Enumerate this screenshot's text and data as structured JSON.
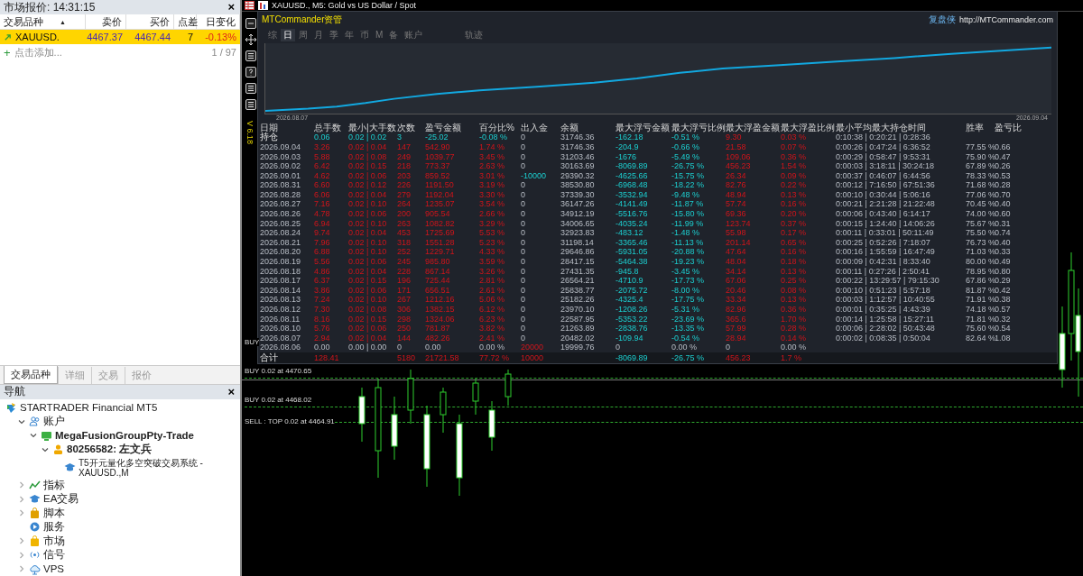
{
  "market_watch": {
    "title": "市场报价: 14:31:15",
    "close": "×",
    "columns": [
      {
        "label": "交易品种",
        "sort": "▲"
      },
      {
        "label": "卖价"
      },
      {
        "label": "买价"
      },
      {
        "label": "点差"
      },
      {
        "label": "日变化"
      }
    ],
    "rows": [
      {
        "selected": true,
        "cells": [
          "XAUUSD.",
          "4467.37",
          "4467.44",
          "7",
          "-0.13%"
        ]
      }
    ],
    "add_row": {
      "icon": "+",
      "label": "点击添加...",
      "count": "1 / 97"
    },
    "tabs": [
      {
        "label": "交易品种",
        "selected": true
      },
      {
        "label": "详细",
        "selected": false
      },
      {
        "label": "交易",
        "selected": false
      },
      {
        "label": "报价",
        "selected": false
      }
    ]
  },
  "navigator": {
    "title": "导航",
    "close": "×",
    "items": [
      {
        "kind": "broker",
        "label": "STARTRADER Financial MT5",
        "children": [
          {
            "kind": "accounts",
            "label": "账户",
            "expanded": true,
            "children": [
              {
                "kind": "server",
                "label": "MegaFusionGroupPty-Trade",
                "expanded": true,
                "children": [
                  {
                    "kind": "user",
                    "label": "80256582: 左文兵",
                    "expanded": true,
                    "children": [
                      {
                        "kind": "expert",
                        "label": "T5开元量化多空突破交易系统 - XAUUSD.,M"
                      }
                    ]
                  }
                ]
              }
            ]
          },
          {
            "kind": "indicators",
            "label": "指标",
            "expanded": false
          },
          {
            "kind": "experts",
            "label": "EA交易",
            "expanded": false
          },
          {
            "kind": "scripts",
            "label": "脚本",
            "expanded": false
          },
          {
            "kind": "services",
            "label": "服务"
          },
          {
            "kind": "market",
            "label": "市场",
            "expanded": false
          },
          {
            "kind": "signals",
            "label": "信号",
            "expanded": false
          },
          {
            "kind": "vps",
            "label": "VPS",
            "expanded": false
          }
        ]
      }
    ]
  },
  "chart": {
    "title": "XAUUSD., M5:  Gold vs US Dollar / Spot",
    "version": "V 6.18",
    "order_lines": [
      {
        "kind": "buy",
        "label": "BUY"
      },
      {
        "kind": "buy",
        "label": "BUY 0.02 at 4470.65"
      },
      {
        "kind": "buy",
        "label": "BUY 0.02 at 4468.02"
      },
      {
        "kind": "sell",
        "label": "SELL : TOP 0.02 at 4464.91"
      }
    ]
  },
  "panel": {
    "title": "MTCommander资管",
    "brand": "复盘侠",
    "url": "http://MTCommander.com",
    "tabs": [
      {
        "label": "综",
        "selected": false
      },
      {
        "label": "日",
        "selected": true
      },
      {
        "label": "周",
        "selected": false
      },
      {
        "label": "月",
        "selected": false
      },
      {
        "label": "季",
        "selected": false
      },
      {
        "label": "年",
        "selected": false
      },
      {
        "label": "币",
        "selected": false
      },
      {
        "label": "M",
        "selected": false
      },
      {
        "label": "备",
        "selected": false
      },
      {
        "label": "账户",
        "selected": false
      },
      {
        "label": "轨迹",
        "selected": false
      }
    ],
    "equity_start": "2026.08.07",
    "equity_end": "2026.09.04",
    "columns": [
      "日期",
      "总手数",
      "最小|大手数",
      "次数",
      "盈亏金额",
      "百分比%",
      "出入金",
      "余额",
      "最大浮亏金额",
      "最大浮亏比例",
      "最大浮盈金额",
      "最大浮盈比例",
      "最小平均最大持仓时间",
      "胜率",
      "盈亏比"
    ],
    "rows": [
      {
        "kind": "position",
        "cells": [
          {
            "text": "持仓",
            "kind": "label"
          },
          {
            "text": "0.06",
            "kind": "loss"
          },
          {
            "text": "0.02 | 0.02",
            "kind": "loss"
          },
          {
            "text": "3",
            "kind": "loss"
          },
          {
            "text": "-25.02",
            "kind": "loss"
          },
          {
            "text": "-0.08 %",
            "kind": "loss"
          },
          {
            "text": "0",
            "kind": "plain"
          },
          {
            "text": "31746.36",
            "kind": "plain"
          },
          {
            "text": "-162.18",
            "kind": "loss"
          },
          {
            "text": "-0.51 %",
            "kind": "loss"
          },
          {
            "text": "9.30",
            "kind": "gain"
          },
          {
            "text": "0.03 %",
            "kind": "gain"
          },
          {
            "text": "0:10:38 | 0:20:21 | 0:28:36",
            "kind": "plain"
          },
          null,
          null
        ]
      },
      {
        "kind": "day",
        "cells": [
          {
            "text": "2026.09.04",
            "kind": "plain"
          },
          {
            "text": "3.26",
            "kind": "gain"
          },
          {
            "text": "0.02 | 0.04",
            "kind": "gain"
          },
          {
            "text": "147",
            "kind": "gain"
          },
          {
            "text": "542.90",
            "kind": "gain"
          },
          {
            "text": "1.74 %",
            "kind": "gain"
          },
          {
            "text": "0",
            "kind": "plain"
          },
          {
            "text": "31746.36",
            "kind": "plain"
          },
          {
            "text": "-204.9",
            "kind": "loss"
          },
          {
            "text": "-0.66 %",
            "kind": "loss"
          },
          {
            "text": "21.58",
            "kind": "gain"
          },
          {
            "text": "0.07 %",
            "kind": "gain"
          },
          {
            "text": "0:00:26 | 0:47:24 | 6:36:52",
            "kind": "plain"
          },
          {
            "text": "77.55 %",
            "kind": "plain"
          },
          {
            "text": "0.66",
            "kind": "plain"
          }
        ]
      },
      {
        "kind": "day",
        "cells": [
          {
            "text": "2026.09.03",
            "kind": "plain"
          },
          {
            "text": "5.88",
            "kind": "gain"
          },
          {
            "text": "0.02 | 0.08",
            "kind": "gain"
          },
          {
            "text": "249",
            "kind": "gain"
          },
          {
            "text": "1039.77",
            "kind": "gain"
          },
          {
            "text": "3.45 %",
            "kind": "gain"
          },
          {
            "text": "0",
            "kind": "plain"
          },
          {
            "text": "31203.46",
            "kind": "plain"
          },
          {
            "text": "-1676",
            "kind": "loss"
          },
          {
            "text": "-5.49 %",
            "kind": "loss"
          },
          {
            "text": "109.06",
            "kind": "gain"
          },
          {
            "text": "0.36 %",
            "kind": "gain"
          },
          {
            "text": "0:00:29 | 0:58:47 | 9:53:31",
            "kind": "plain"
          },
          {
            "text": "75.90 %",
            "kind": "plain"
          },
          {
            "text": "0.47",
            "kind": "plain"
          }
        ]
      },
      {
        "kind": "day",
        "cells": [
          {
            "text": "2026.09.02",
            "kind": "plain"
          },
          {
            "text": "6.42",
            "kind": "gain"
          },
          {
            "text": "0.02 | 0.15",
            "kind": "gain"
          },
          {
            "text": "218",
            "kind": "gain"
          },
          {
            "text": "773.37",
            "kind": "gain"
          },
          {
            "text": "2.63 %",
            "kind": "gain"
          },
          {
            "text": "0",
            "kind": "plain"
          },
          {
            "text": "30163.69",
            "kind": "plain"
          },
          {
            "text": "-8069.89",
            "kind": "loss"
          },
          {
            "text": "-26.75 %",
            "kind": "loss"
          },
          {
            "text": "456.23",
            "kind": "gain"
          },
          {
            "text": "1.54 %",
            "kind": "gain"
          },
          {
            "text": "0:00:03 | 3:18:11 | 30:24:18",
            "kind": "plain"
          },
          {
            "text": "67.89 %",
            "kind": "plain"
          },
          {
            "text": "0.26",
            "kind": "plain"
          }
        ]
      },
      {
        "kind": "day",
        "cells": [
          {
            "text": "2026.09.01",
            "kind": "plain"
          },
          {
            "text": "4.62",
            "kind": "gain"
          },
          {
            "text": "0.02 | 0.06",
            "kind": "gain"
          },
          {
            "text": "203",
            "kind": "gain"
          },
          {
            "text": "859.52",
            "kind": "gain"
          },
          {
            "text": "3.01 %",
            "kind": "gain"
          },
          {
            "text": "-10000",
            "kind": "loss"
          },
          {
            "text": "29390.32",
            "kind": "plain"
          },
          {
            "text": "-4625.66",
            "kind": "loss"
          },
          {
            "text": "-15.75 %",
            "kind": "loss"
          },
          {
            "text": "26.34",
            "kind": "gain"
          },
          {
            "text": "0.09 %",
            "kind": "gain"
          },
          {
            "text": "0:00:37 | 0:46:07 | 6:44:56",
            "kind": "plain"
          },
          {
            "text": "78.33 %",
            "kind": "plain"
          },
          {
            "text": "0.53",
            "kind": "plain"
          }
        ]
      },
      {
        "kind": "day",
        "cells": [
          {
            "text": "2026.08.31",
            "kind": "plain"
          },
          {
            "text": "6.60",
            "kind": "gain"
          },
          {
            "text": "0.02 | 0.12",
            "kind": "gain"
          },
          {
            "text": "226",
            "kind": "gain"
          },
          {
            "text": "1191.50",
            "kind": "gain"
          },
          {
            "text": "3.19 %",
            "kind": "gain"
          },
          {
            "text": "0",
            "kind": "plain"
          },
          {
            "text": "38530.80",
            "kind": "plain"
          },
          {
            "text": "-6968.48",
            "kind": "loss"
          },
          {
            "text": "-18.22 %",
            "kind": "loss"
          },
          {
            "text": "82.76",
            "kind": "gain"
          },
          {
            "text": "0.22 %",
            "kind": "gain"
          },
          {
            "text": "0:00:12 | 7:16:50 | 67:51:36",
            "kind": "plain"
          },
          {
            "text": "71.68 %",
            "kind": "plain"
          },
          {
            "text": "0.28",
            "kind": "plain"
          }
        ]
      },
      {
        "kind": "day",
        "cells": [
          {
            "text": "2026.08.28",
            "kind": "plain"
          },
          {
            "text": "6.06",
            "kind": "gain"
          },
          {
            "text": "0.02 | 0.04",
            "kind": "gain"
          },
          {
            "text": "279",
            "kind": "gain"
          },
          {
            "text": "1192.04",
            "kind": "gain"
          },
          {
            "text": "3.30 %",
            "kind": "gain"
          },
          {
            "text": "0",
            "kind": "plain"
          },
          {
            "text": "37339.30",
            "kind": "plain"
          },
          {
            "text": "-3532.94",
            "kind": "loss"
          },
          {
            "text": "-9.48 %",
            "kind": "loss"
          },
          {
            "text": "48.94",
            "kind": "gain"
          },
          {
            "text": "0.13 %",
            "kind": "gain"
          },
          {
            "text": "0:00:10 | 0:30:44 | 5:06:16",
            "kind": "plain"
          },
          {
            "text": "77.06 %",
            "kind": "plain"
          },
          {
            "text": "0.70",
            "kind": "plain"
          }
        ]
      },
      {
        "kind": "day",
        "cells": [
          {
            "text": "2026.08.27",
            "kind": "plain"
          },
          {
            "text": "7.16",
            "kind": "gain"
          },
          {
            "text": "0.02 | 0.10",
            "kind": "gain"
          },
          {
            "text": "264",
            "kind": "gain"
          },
          {
            "text": "1235.07",
            "kind": "gain"
          },
          {
            "text": "3.54 %",
            "kind": "gain"
          },
          {
            "text": "0",
            "kind": "plain"
          },
          {
            "text": "36147.26",
            "kind": "plain"
          },
          {
            "text": "-4141.49",
            "kind": "loss"
          },
          {
            "text": "-11.87 %",
            "kind": "loss"
          },
          {
            "text": "57.74",
            "kind": "gain"
          },
          {
            "text": "0.16 %",
            "kind": "gain"
          },
          {
            "text": "0:00:21 | 2:21:28 | 21:22:48",
            "kind": "plain"
          },
          {
            "text": "70.45 %",
            "kind": "plain"
          },
          {
            "text": "0.40",
            "kind": "plain"
          }
        ]
      },
      {
        "kind": "day",
        "cells": [
          {
            "text": "2026.08.26",
            "kind": "plain"
          },
          {
            "text": "4.78",
            "kind": "gain"
          },
          {
            "text": "0.02 | 0.06",
            "kind": "gain"
          },
          {
            "text": "200",
            "kind": "gain"
          },
          {
            "text": "905.54",
            "kind": "gain"
          },
          {
            "text": "2.66 %",
            "kind": "gain"
          },
          {
            "text": "0",
            "kind": "plain"
          },
          {
            "text": "34912.19",
            "kind": "plain"
          },
          {
            "text": "-5516.76",
            "kind": "loss"
          },
          {
            "text": "-15.80 %",
            "kind": "loss"
          },
          {
            "text": "69.36",
            "kind": "gain"
          },
          {
            "text": "0.20 %",
            "kind": "gain"
          },
          {
            "text": "0:00:06 | 0:43:40 | 6:14:17",
            "kind": "plain"
          },
          {
            "text": "74.00 %",
            "kind": "plain"
          },
          {
            "text": "0.60",
            "kind": "plain"
          }
        ]
      },
      {
        "kind": "day",
        "cells": [
          {
            "text": "2026.08.25",
            "kind": "plain"
          },
          {
            "text": "6.94",
            "kind": "gain"
          },
          {
            "text": "0.02 | 0.10",
            "kind": "gain"
          },
          {
            "text": "263",
            "kind": "gain"
          },
          {
            "text": "1082.82",
            "kind": "gain"
          },
          {
            "text": "3.29 %",
            "kind": "gain"
          },
          {
            "text": "0",
            "kind": "plain"
          },
          {
            "text": "34006.65",
            "kind": "plain"
          },
          {
            "text": "-4035.24",
            "kind": "loss"
          },
          {
            "text": "-11.99 %",
            "kind": "loss"
          },
          {
            "text": "123.74",
            "kind": "gain"
          },
          {
            "text": "0.37 %",
            "kind": "gain"
          },
          {
            "text": "0:00:15 | 1:24:40 | 14:06:26",
            "kind": "plain"
          },
          {
            "text": "75.67 %",
            "kind": "plain"
          },
          {
            "text": "0.31",
            "kind": "plain"
          }
        ]
      },
      {
        "kind": "day",
        "cells": [
          {
            "text": "2026.08.24",
            "kind": "plain"
          },
          {
            "text": "9.74",
            "kind": "gain"
          },
          {
            "text": "0.02 | 0.04",
            "kind": "gain"
          },
          {
            "text": "453",
            "kind": "gain"
          },
          {
            "text": "1725.69",
            "kind": "gain"
          },
          {
            "text": "5.53 %",
            "kind": "gain"
          },
          {
            "text": "0",
            "kind": "plain"
          },
          {
            "text": "32923.83",
            "kind": "plain"
          },
          {
            "text": "-483.12",
            "kind": "loss"
          },
          {
            "text": "-1.48 %",
            "kind": "loss"
          },
          {
            "text": "55.98",
            "kind": "gain"
          },
          {
            "text": "0.17 %",
            "kind": "gain"
          },
          {
            "text": "0:00:11 | 0:33:01 | 50:11:49",
            "kind": "plain"
          },
          {
            "text": "75.50 %",
            "kind": "plain"
          },
          {
            "text": "0.74",
            "kind": "plain"
          }
        ]
      },
      {
        "kind": "day",
        "cells": [
          {
            "text": "2026.08.21",
            "kind": "plain"
          },
          {
            "text": "7.96",
            "kind": "gain"
          },
          {
            "text": "0.02 | 0.10",
            "kind": "gain"
          },
          {
            "text": "318",
            "kind": "gain"
          },
          {
            "text": "1551.28",
            "kind": "gain"
          },
          {
            "text": "5.23 %",
            "kind": "gain"
          },
          {
            "text": "0",
            "kind": "plain"
          },
          {
            "text": "31198.14",
            "kind": "plain"
          },
          {
            "text": "-3365.46",
            "kind": "loss"
          },
          {
            "text": "-11.13 %",
            "kind": "loss"
          },
          {
            "text": "201.14",
            "kind": "gain"
          },
          {
            "text": "0.65 %",
            "kind": "gain"
          },
          {
            "text": "0:00:25 | 0:52:26 | 7:18:07",
            "kind": "plain"
          },
          {
            "text": "76.73 %",
            "kind": "plain"
          },
          {
            "text": "0.40",
            "kind": "plain"
          }
        ]
      },
      {
        "kind": "day",
        "cells": [
          {
            "text": "2026.08.20",
            "kind": "plain"
          },
          {
            "text": "6.88",
            "kind": "gain"
          },
          {
            "text": "0.02 | 0.10",
            "kind": "gain"
          },
          {
            "text": "252",
            "kind": "gain"
          },
          {
            "text": "1229.71",
            "kind": "gain"
          },
          {
            "text": "4.33 %",
            "kind": "gain"
          },
          {
            "text": "0",
            "kind": "plain"
          },
          {
            "text": "29646.86",
            "kind": "plain"
          },
          {
            "text": "-5931.05",
            "kind": "loss"
          },
          {
            "text": "-20.88 %",
            "kind": "loss"
          },
          {
            "text": "47.64",
            "kind": "gain"
          },
          {
            "text": "0.16 %",
            "kind": "gain"
          },
          {
            "text": "0:00:16 | 1:55:59 | 16:47:49",
            "kind": "plain"
          },
          {
            "text": "71.03 %",
            "kind": "plain"
          },
          {
            "text": "0.33",
            "kind": "plain"
          }
        ]
      },
      {
        "kind": "day",
        "cells": [
          {
            "text": "2026.08.19",
            "kind": "plain"
          },
          {
            "text": "5.56",
            "kind": "gain"
          },
          {
            "text": "0.02 | 0.06",
            "kind": "gain"
          },
          {
            "text": "245",
            "kind": "gain"
          },
          {
            "text": "985.80",
            "kind": "gain"
          },
          {
            "text": "3.59 %",
            "kind": "gain"
          },
          {
            "text": "0",
            "kind": "plain"
          },
          {
            "text": "28417.15",
            "kind": "plain"
          },
          {
            "text": "-5464.38",
            "kind": "loss"
          },
          {
            "text": "-19.23 %",
            "kind": "loss"
          },
          {
            "text": "48.04",
            "kind": "gain"
          },
          {
            "text": "0.18 %",
            "kind": "gain"
          },
          {
            "text": "0:00:09 | 0:42:31 | 8:33:40",
            "kind": "plain"
          },
          {
            "text": "80.00 %",
            "kind": "plain"
          },
          {
            "text": "0.49",
            "kind": "plain"
          }
        ]
      },
      {
        "kind": "day",
        "cells": [
          {
            "text": "2026.08.18",
            "kind": "plain"
          },
          {
            "text": "4.86",
            "kind": "gain"
          },
          {
            "text": "0.02 | 0.04",
            "kind": "gain"
          },
          {
            "text": "228",
            "kind": "gain"
          },
          {
            "text": "867.14",
            "kind": "gain"
          },
          {
            "text": "3.26 %",
            "kind": "gain"
          },
          {
            "text": "0",
            "kind": "plain"
          },
          {
            "text": "27431.35",
            "kind": "plain"
          },
          {
            "text": "-945.8",
            "kind": "loss"
          },
          {
            "text": "-3.45 %",
            "kind": "loss"
          },
          {
            "text": "34.14",
            "kind": "gain"
          },
          {
            "text": "0.13 %",
            "kind": "gain"
          },
          {
            "text": "0:00:11 | 0:27:26 | 2:50:41",
            "kind": "plain"
          },
          {
            "text": "78.95 %",
            "kind": "plain"
          },
          {
            "text": "0.80",
            "kind": "plain"
          }
        ]
      },
      {
        "kind": "day",
        "cells": [
          {
            "text": "2026.08.17",
            "kind": "plain"
          },
          {
            "text": "6.37",
            "kind": "gain"
          },
          {
            "text": "0.02 | 0.15",
            "kind": "gain"
          },
          {
            "text": "196",
            "kind": "gain"
          },
          {
            "text": "725.44",
            "kind": "gain"
          },
          {
            "text": "2.81 %",
            "kind": "gain"
          },
          {
            "text": "0",
            "kind": "plain"
          },
          {
            "text": "26564.21",
            "kind": "plain"
          },
          {
            "text": "-4710.9",
            "kind": "loss"
          },
          {
            "text": "-17.73 %",
            "kind": "loss"
          },
          {
            "text": "67.06",
            "kind": "gain"
          },
          {
            "text": "0.25 %",
            "kind": "gain"
          },
          {
            "text": "0:00:22 | 13:29:57 | 79:15:30",
            "kind": "plain"
          },
          {
            "text": "67.86 %",
            "kind": "plain"
          },
          {
            "text": "0.29",
            "kind": "plain"
          }
        ]
      },
      {
        "kind": "day",
        "cells": [
          {
            "text": "2026.08.14",
            "kind": "plain"
          },
          {
            "text": "3.86",
            "kind": "gain"
          },
          {
            "text": "0.02 | 0.06",
            "kind": "gain"
          },
          {
            "text": "171",
            "kind": "gain"
          },
          {
            "text": "656.51",
            "kind": "gain"
          },
          {
            "text": "2.61 %",
            "kind": "gain"
          },
          {
            "text": "0",
            "kind": "plain"
          },
          {
            "text": "25838.77",
            "kind": "plain"
          },
          {
            "text": "-2075.72",
            "kind": "loss"
          },
          {
            "text": "-8.00 %",
            "kind": "loss"
          },
          {
            "text": "20.46",
            "kind": "gain"
          },
          {
            "text": "0.08 %",
            "kind": "gain"
          },
          {
            "text": "0:00:10 | 0:51:23 | 5:57:18",
            "kind": "plain"
          },
          {
            "text": "81.87 %",
            "kind": "plain"
          },
          {
            "text": "0.42",
            "kind": "plain"
          }
        ]
      },
      {
        "kind": "day",
        "cells": [
          {
            "text": "2026.08.13",
            "kind": "plain"
          },
          {
            "text": "7.24",
            "kind": "gain"
          },
          {
            "text": "0.02 | 0.10",
            "kind": "gain"
          },
          {
            "text": "267",
            "kind": "gain"
          },
          {
            "text": "1212.16",
            "kind": "gain"
          },
          {
            "text": "5.06 %",
            "kind": "gain"
          },
          {
            "text": "0",
            "kind": "plain"
          },
          {
            "text": "25182.26",
            "kind": "plain"
          },
          {
            "text": "-4325.4",
            "kind": "loss"
          },
          {
            "text": "-17.75 %",
            "kind": "loss"
          },
          {
            "text": "33.34",
            "kind": "gain"
          },
          {
            "text": "0.13 %",
            "kind": "gain"
          },
          {
            "text": "0:00:03 | 1:12:57 | 10:40:55",
            "kind": "plain"
          },
          {
            "text": "71.91 %",
            "kind": "plain"
          },
          {
            "text": "0.38",
            "kind": "plain"
          }
        ]
      },
      {
        "kind": "day",
        "cells": [
          {
            "text": "2026.08.12",
            "kind": "plain"
          },
          {
            "text": "7.30",
            "kind": "gain"
          },
          {
            "text": "0.02 | 0.08",
            "kind": "gain"
          },
          {
            "text": "306",
            "kind": "gain"
          },
          {
            "text": "1382.15",
            "kind": "gain"
          },
          {
            "text": "6.12 %",
            "kind": "gain"
          },
          {
            "text": "0",
            "kind": "plain"
          },
          {
            "text": "23970.10",
            "kind": "plain"
          },
          {
            "text": "-1208.26",
            "kind": "loss"
          },
          {
            "text": "-5.31 %",
            "kind": "loss"
          },
          {
            "text": "82.96",
            "kind": "gain"
          },
          {
            "text": "0.36 %",
            "kind": "gain"
          },
          {
            "text": "0:00:01 | 0:35:25 | 4:43:39",
            "kind": "plain"
          },
          {
            "text": "74.18 %",
            "kind": "plain"
          },
          {
            "text": "0.57",
            "kind": "plain"
          }
        ]
      },
      {
        "kind": "day",
        "cells": [
          {
            "text": "2026.08.11",
            "kind": "plain"
          },
          {
            "text": "8.16",
            "kind": "gain"
          },
          {
            "text": "0.02 | 0.15",
            "kind": "gain"
          },
          {
            "text": "298",
            "kind": "gain"
          },
          {
            "text": "1324.06",
            "kind": "gain"
          },
          {
            "text": "6.23 %",
            "kind": "gain"
          },
          {
            "text": "0",
            "kind": "plain"
          },
          {
            "text": "22587.95",
            "kind": "plain"
          },
          {
            "text": "-5353.22",
            "kind": "loss"
          },
          {
            "text": "-23.69 %",
            "kind": "loss"
          },
          {
            "text": "365.6",
            "kind": "gain"
          },
          {
            "text": "1.70 %",
            "kind": "gain"
          },
          {
            "text": "0:00:14 | 1:25:58 | 15:27:11",
            "kind": "plain"
          },
          {
            "text": "71.81 %",
            "kind": "plain"
          },
          {
            "text": "0.32",
            "kind": "plain"
          }
        ]
      },
      {
        "kind": "day",
        "cells": [
          {
            "text": "2026.08.10",
            "kind": "plain"
          },
          {
            "text": "5.76",
            "kind": "gain"
          },
          {
            "text": "0.02 | 0.06",
            "kind": "gain"
          },
          {
            "text": "250",
            "kind": "gain"
          },
          {
            "text": "781.87",
            "kind": "gain"
          },
          {
            "text": "3.82 %",
            "kind": "gain"
          },
          {
            "text": "0",
            "kind": "plain"
          },
          {
            "text": "21263.89",
            "kind": "plain"
          },
          {
            "text": "-2838.76",
            "kind": "loss"
          },
          {
            "text": "-13.35 %",
            "kind": "loss"
          },
          {
            "text": "57.99",
            "kind": "gain"
          },
          {
            "text": "0.28 %",
            "kind": "gain"
          },
          {
            "text": "0:00:06 | 2:28:02 | 50:43:48",
            "kind": "plain"
          },
          {
            "text": "75.60 %",
            "kind": "plain"
          },
          {
            "text": "0.54",
            "kind": "plain"
          }
        ]
      },
      {
        "kind": "day",
        "cells": [
          {
            "text": "2026.08.07",
            "kind": "plain"
          },
          {
            "text": "2.94",
            "kind": "gain"
          },
          {
            "text": "0.02 | 0.04",
            "kind": "gain"
          },
          {
            "text": "144",
            "kind": "gain"
          },
          {
            "text": "482.26",
            "kind": "gain"
          },
          {
            "text": "2.41 %",
            "kind": "gain"
          },
          {
            "text": "0",
            "kind": "plain"
          },
          {
            "text": "20482.02",
            "kind": "plain"
          },
          {
            "text": "-109.94",
            "kind": "loss"
          },
          {
            "text": "-0.54 %",
            "kind": "loss"
          },
          {
            "text": "28.94",
            "kind": "gain"
          },
          {
            "text": "0.14 %",
            "kind": "gain"
          },
          {
            "text": "0:00:02 | 0:08:35 | 0:50:04",
            "kind": "plain"
          },
          {
            "text": "82.64 %",
            "kind": "plain"
          },
          {
            "text": "1.08",
            "kind": "plain"
          }
        ]
      },
      {
        "kind": "day",
        "cells": [
          {
            "text": "2026.08.06",
            "kind": "plain"
          },
          {
            "text": "0.00",
            "kind": "plain"
          },
          {
            "text": "0.00 | 0.00",
            "kind": "plain"
          },
          {
            "text": "0",
            "kind": "plain"
          },
          {
            "text": "0.00",
            "kind": "plain"
          },
          {
            "text": "0.00 %",
            "kind": "plain"
          },
          {
            "text": "20000",
            "kind": "gain"
          },
          {
            "text": "19999.76",
            "kind": "plain"
          },
          {
            "text": "0",
            "kind": "plain"
          },
          {
            "text": "0.00 %",
            "kind": "plain"
          },
          {
            "text": "0",
            "kind": "plain"
          },
          {
            "text": "0.00 %",
            "kind": "plain"
          },
          null,
          null,
          null
        ]
      },
      {
        "kind": "total",
        "cells": [
          {
            "text": "合计",
            "kind": "label"
          },
          {
            "text": "128.41",
            "kind": "gain"
          },
          null,
          {
            "text": "5180",
            "kind": "gain"
          },
          {
            "text": "21721.58",
            "kind": "gain"
          },
          {
            "text": "77.72 %",
            "kind": "gain"
          },
          {
            "text": "10000",
            "kind": "gain"
          },
          null,
          {
            "text": "-8069.89",
            "kind": "loss"
          },
          {
            "text": "-26.75 %",
            "kind": "loss"
          },
          {
            "text": "456.23",
            "kind": "gain"
          },
          {
            "text": "1.7 %",
            "kind": "gain"
          },
          null,
          null,
          null
        ]
      }
    ]
  }
}
